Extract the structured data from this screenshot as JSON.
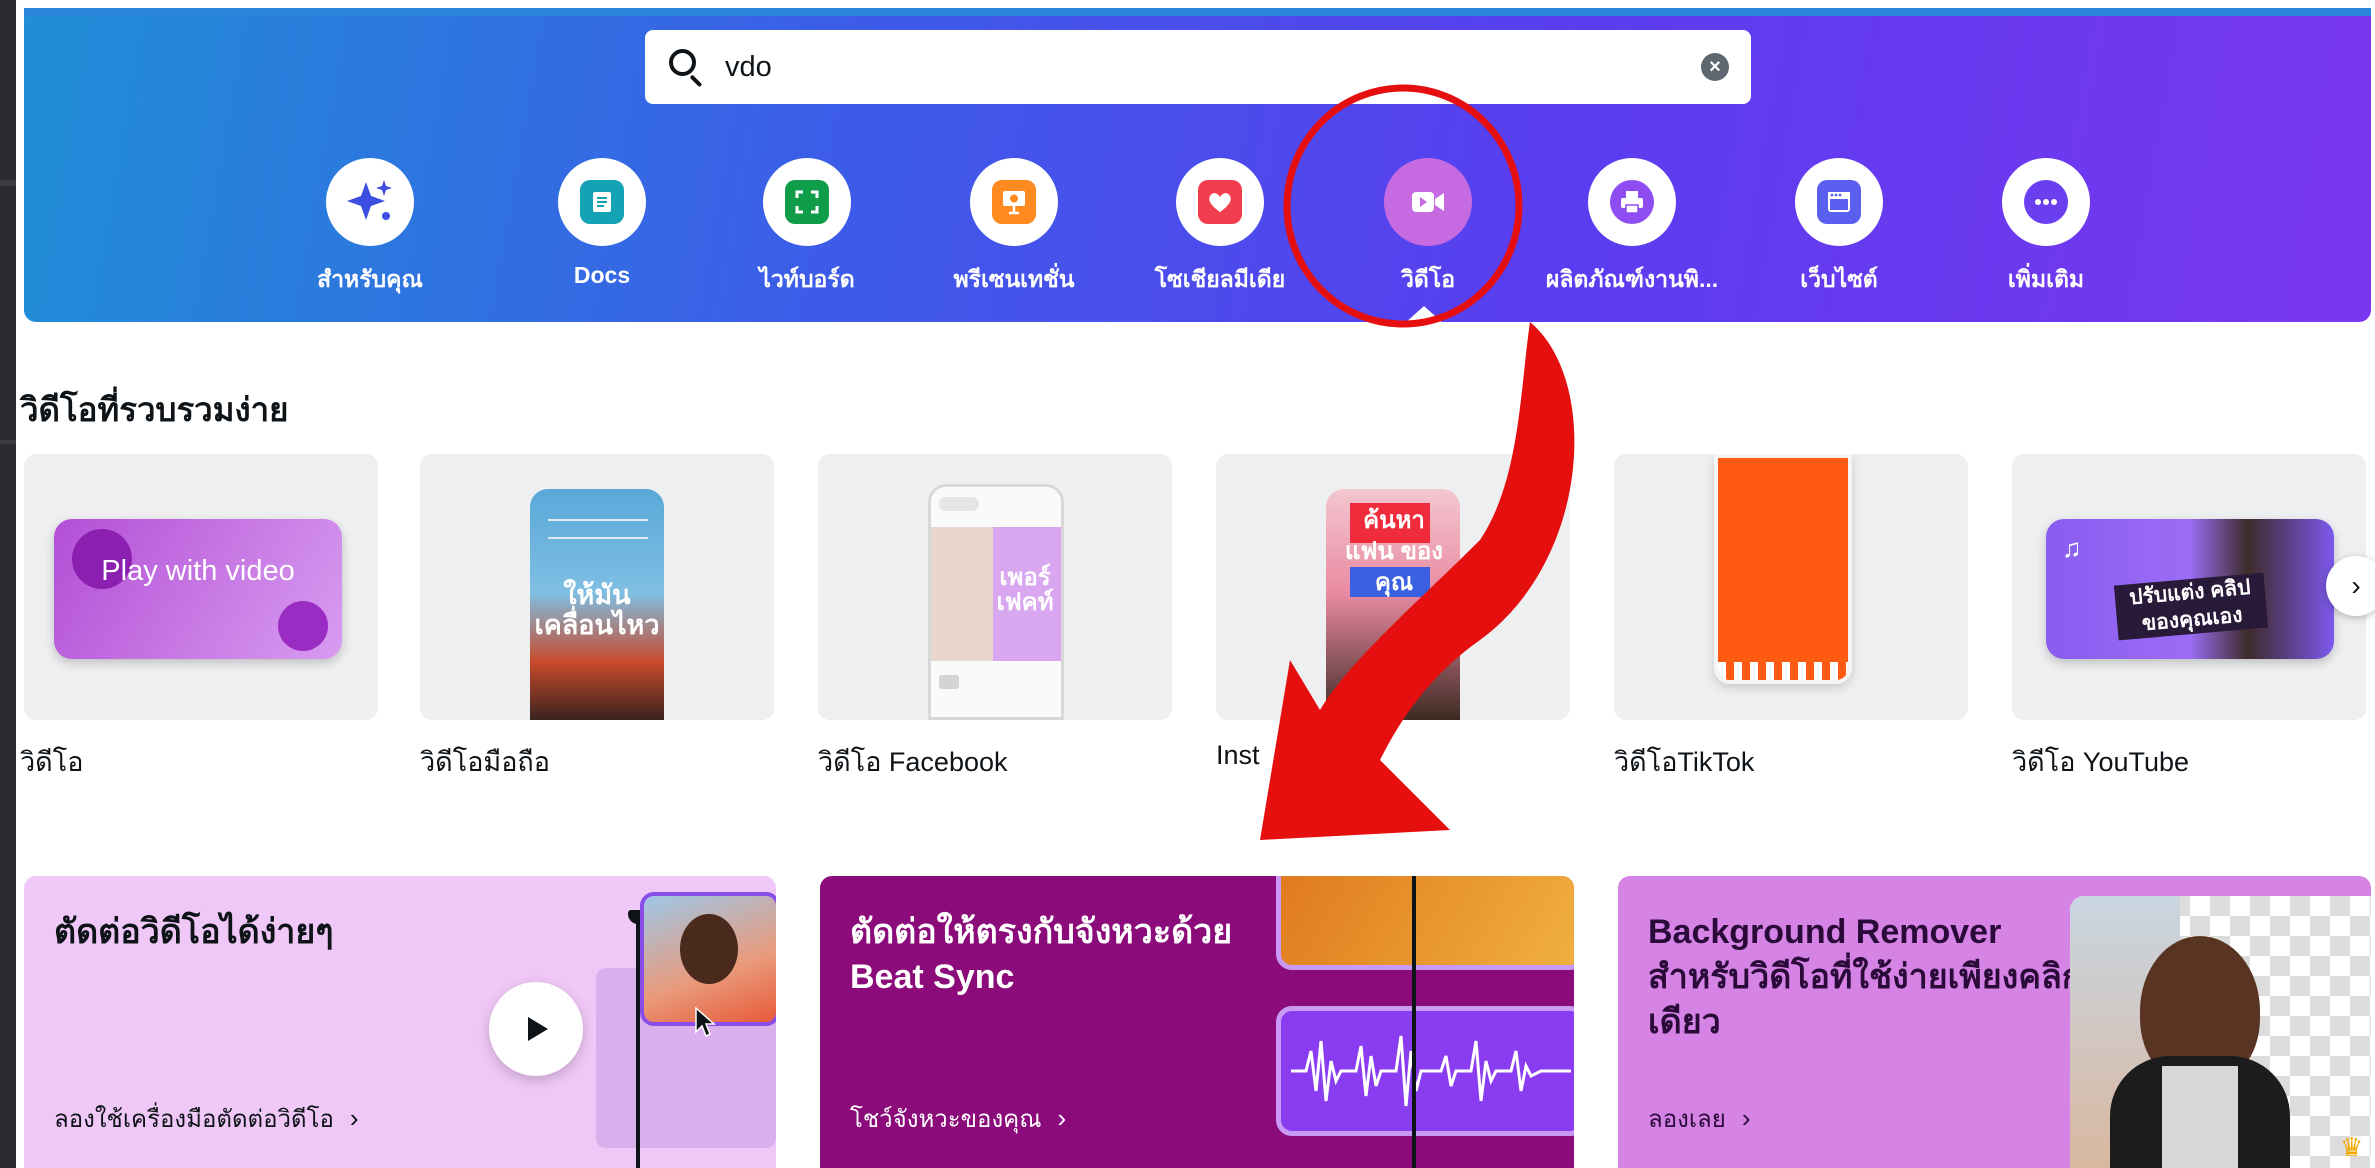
{
  "search": {
    "value": "vdo",
    "placeholder": ""
  },
  "categories": [
    {
      "label": "สำหรับคุณ",
      "icon": "sparkle-icon"
    },
    {
      "label": "Docs",
      "icon": "docs-icon"
    },
    {
      "label": "ไวท์บอร์ด",
      "icon": "whiteboard-icon"
    },
    {
      "label": "พรีเซนเทชั่น",
      "icon": "presentation-icon"
    },
    {
      "label": "โซเชียลมีเดีย",
      "icon": "heart-icon"
    },
    {
      "label": "วิดีโอ",
      "icon": "video-camera-icon",
      "active": true
    },
    {
      "label": "ผลิตภัณฑ์งานพิ...",
      "icon": "printer-icon"
    },
    {
      "label": "เว็บไซต์",
      "icon": "browser-window-icon"
    },
    {
      "label": "เพิ่มเติม",
      "icon": "more-dots-icon"
    }
  ],
  "section": {
    "title": "วิดีโอที่รวบรวมง่าย"
  },
  "tiles": [
    {
      "label": "วิดีโอ",
      "art_text": "Play with video"
    },
    {
      "label": "วิดีโอมือถือ",
      "art_text": "ให้มัน เคลื่อนไหว"
    },
    {
      "label": "วิดีโอ Facebook",
      "art_text": "เพอร์ เฟคท์"
    },
    {
      "label": "Inst",
      "art_text": "ค้นหา แฟน ของคุณ"
    },
    {
      "label": "วิดีโอTikTok",
      "art_text": ""
    },
    {
      "label": "วิดีโอ YouTube",
      "art_text": "ปรับแต่ง คลิปของคุณเอง"
    }
  ],
  "promos": [
    {
      "title": "ตัดต่อวิดีโอได้ง่ายๆ",
      "link": "ลองใช้เครื่องมือตัดต่อวิดีโอ",
      "bg": "#f0c8f7",
      "color": "#0e1318"
    },
    {
      "title": "ตัดต่อให้ตรงกับจังหวะด้วย Beat Sync",
      "link": "โชว์จังหวะของคุณ",
      "bg": "#8a0b79",
      "color": "#ffffff"
    },
    {
      "title": "Background Remover สำหรับวิดีโอที่ใช้ง่ายเพียงคลิกเดียว",
      "link": "ลองเลย",
      "bg": "#d683e6",
      "color": "#2a0a38"
    }
  ],
  "colors": {
    "hero_start": "#1f8fd6",
    "hero_end": "#7a36ee",
    "annotation": "#e60f0f",
    "active_category": "#c56ae0"
  }
}
